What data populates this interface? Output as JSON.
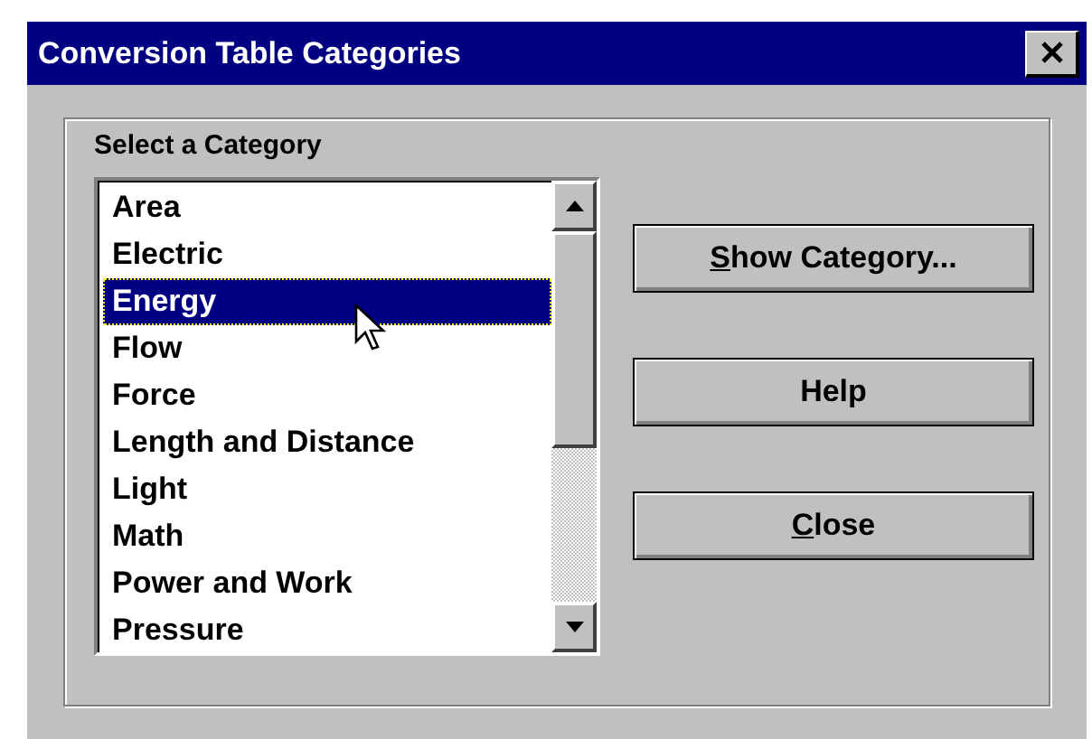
{
  "window": {
    "title": "Conversion Table Categories"
  },
  "group": {
    "label": "Select a Category"
  },
  "list": {
    "items": [
      {
        "label": "Area",
        "selected": false
      },
      {
        "label": "Electric",
        "selected": false
      },
      {
        "label": "Energy",
        "selected": true
      },
      {
        "label": "Flow",
        "selected": false
      },
      {
        "label": "Force",
        "selected": false
      },
      {
        "label": "Length and Distance",
        "selected": false
      },
      {
        "label": "Light",
        "selected": false
      },
      {
        "label": "Math",
        "selected": false
      },
      {
        "label": "Power and Work",
        "selected": false
      },
      {
        "label": "Pressure",
        "selected": false
      }
    ]
  },
  "buttons": [
    {
      "mnemonic": "S",
      "rest": "how Category..."
    },
    {
      "rest": "Help"
    },
    {
      "mnemonic": "C",
      "rest": "lose"
    }
  ]
}
